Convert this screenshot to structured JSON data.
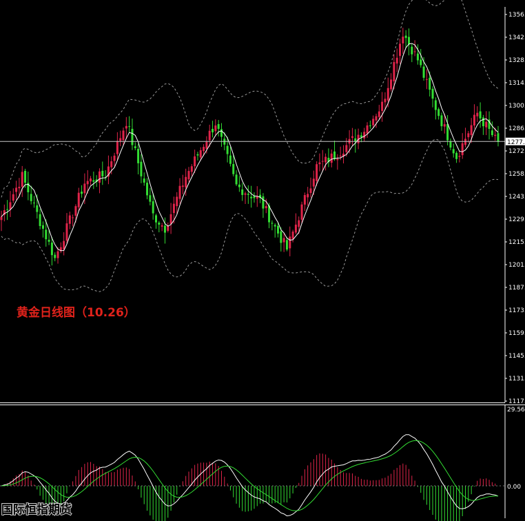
{
  "annotation": "黄金日线图（10.26）",
  "watermark": "国际恒指期货",
  "colors": {
    "background": "#000000",
    "bull_candle": "#e0244a",
    "bear_candle": "#33dd33",
    "ma_line": "#ffffff",
    "band_line": "#9a9a9a",
    "macd_fast": "#ffffff",
    "macd_signal": "#33dd33",
    "hist_pos": "#e0244a",
    "hist_neg": "#33dd33",
    "price_line": "#c8c8c8"
  },
  "chart_data": [
    {
      "type": "candlestick",
      "title": "",
      "y_ticks": [
        "1356.",
        "1342.",
        "1328.",
        "1314.",
        "1300.",
        "1286.",
        "1272.",
        "1258.",
        "1243.",
        "1229.",
        "1215.",
        "1201.",
        "1187.",
        "1173.",
        "1159.",
        "1145.",
        "1131.",
        "1117."
      ],
      "ylim": [
        1117,
        1357
      ],
      "current_price_label": "1277.",
      "current_price": 1277.5,
      "bollinger": true,
      "moving_average": true,
      "close_path": [
        {
          "i": 0,
          "v": 1231
        },
        {
          "i": 7,
          "v": 1256
        },
        {
          "i": 18,
          "v": 1205
        },
        {
          "i": 28,
          "v": 1252
        },
        {
          "i": 35,
          "v": 1257
        },
        {
          "i": 42,
          "v": 1290
        },
        {
          "i": 51,
          "v": 1232
        },
        {
          "i": 55,
          "v": 1224
        },
        {
          "i": 62,
          "v": 1256
        },
        {
          "i": 72,
          "v": 1289
        },
        {
          "i": 79,
          "v": 1250
        },
        {
          "i": 87,
          "v": 1241
        },
        {
          "i": 96,
          "v": 1211
        },
        {
          "i": 106,
          "v": 1262
        },
        {
          "i": 113,
          "v": 1270
        },
        {
          "i": 122,
          "v": 1285
        },
        {
          "i": 128,
          "v": 1300
        },
        {
          "i": 135,
          "v": 1345
        },
        {
          "i": 140,
          "v": 1328
        },
        {
          "i": 145,
          "v": 1303
        },
        {
          "i": 153,
          "v": 1268
        },
        {
          "i": 160,
          "v": 1295
        },
        {
          "i": 167,
          "v": 1276
        }
      ]
    },
    {
      "type": "macd",
      "y_ticks": [
        "29.56",
        "0.00"
      ],
      "ylim": [
        -14,
        29.56
      ]
    }
  ]
}
